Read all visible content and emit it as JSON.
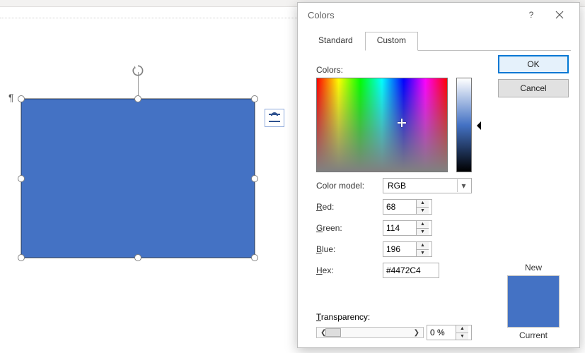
{
  "canvas": {
    "shape_fill": "#4472C4",
    "shape_border": "#2F528F"
  },
  "dialog": {
    "title": "Colors",
    "tabs": {
      "standard": "Standard",
      "custom": "Custom"
    },
    "buttons": {
      "ok": "OK",
      "cancel": "Cancel"
    },
    "labels": {
      "colors": "Colors:",
      "color_model": "Color model:",
      "red": "Red:",
      "red_key": "R",
      "green": "Green:",
      "green_key": "G",
      "blue": "Blue:",
      "blue_key": "B",
      "hex": "Hex:",
      "hex_key": "H",
      "transparency": "Transparency:",
      "transparency_key": "T",
      "new": "New",
      "current": "Current"
    },
    "values": {
      "color_model": "RGB",
      "red": "68",
      "green": "114",
      "blue": "196",
      "hex": "#4472C4",
      "transparency": "0 %"
    },
    "preview": {
      "new_color": "#4472C4",
      "current_color": "#4472C4"
    }
  }
}
